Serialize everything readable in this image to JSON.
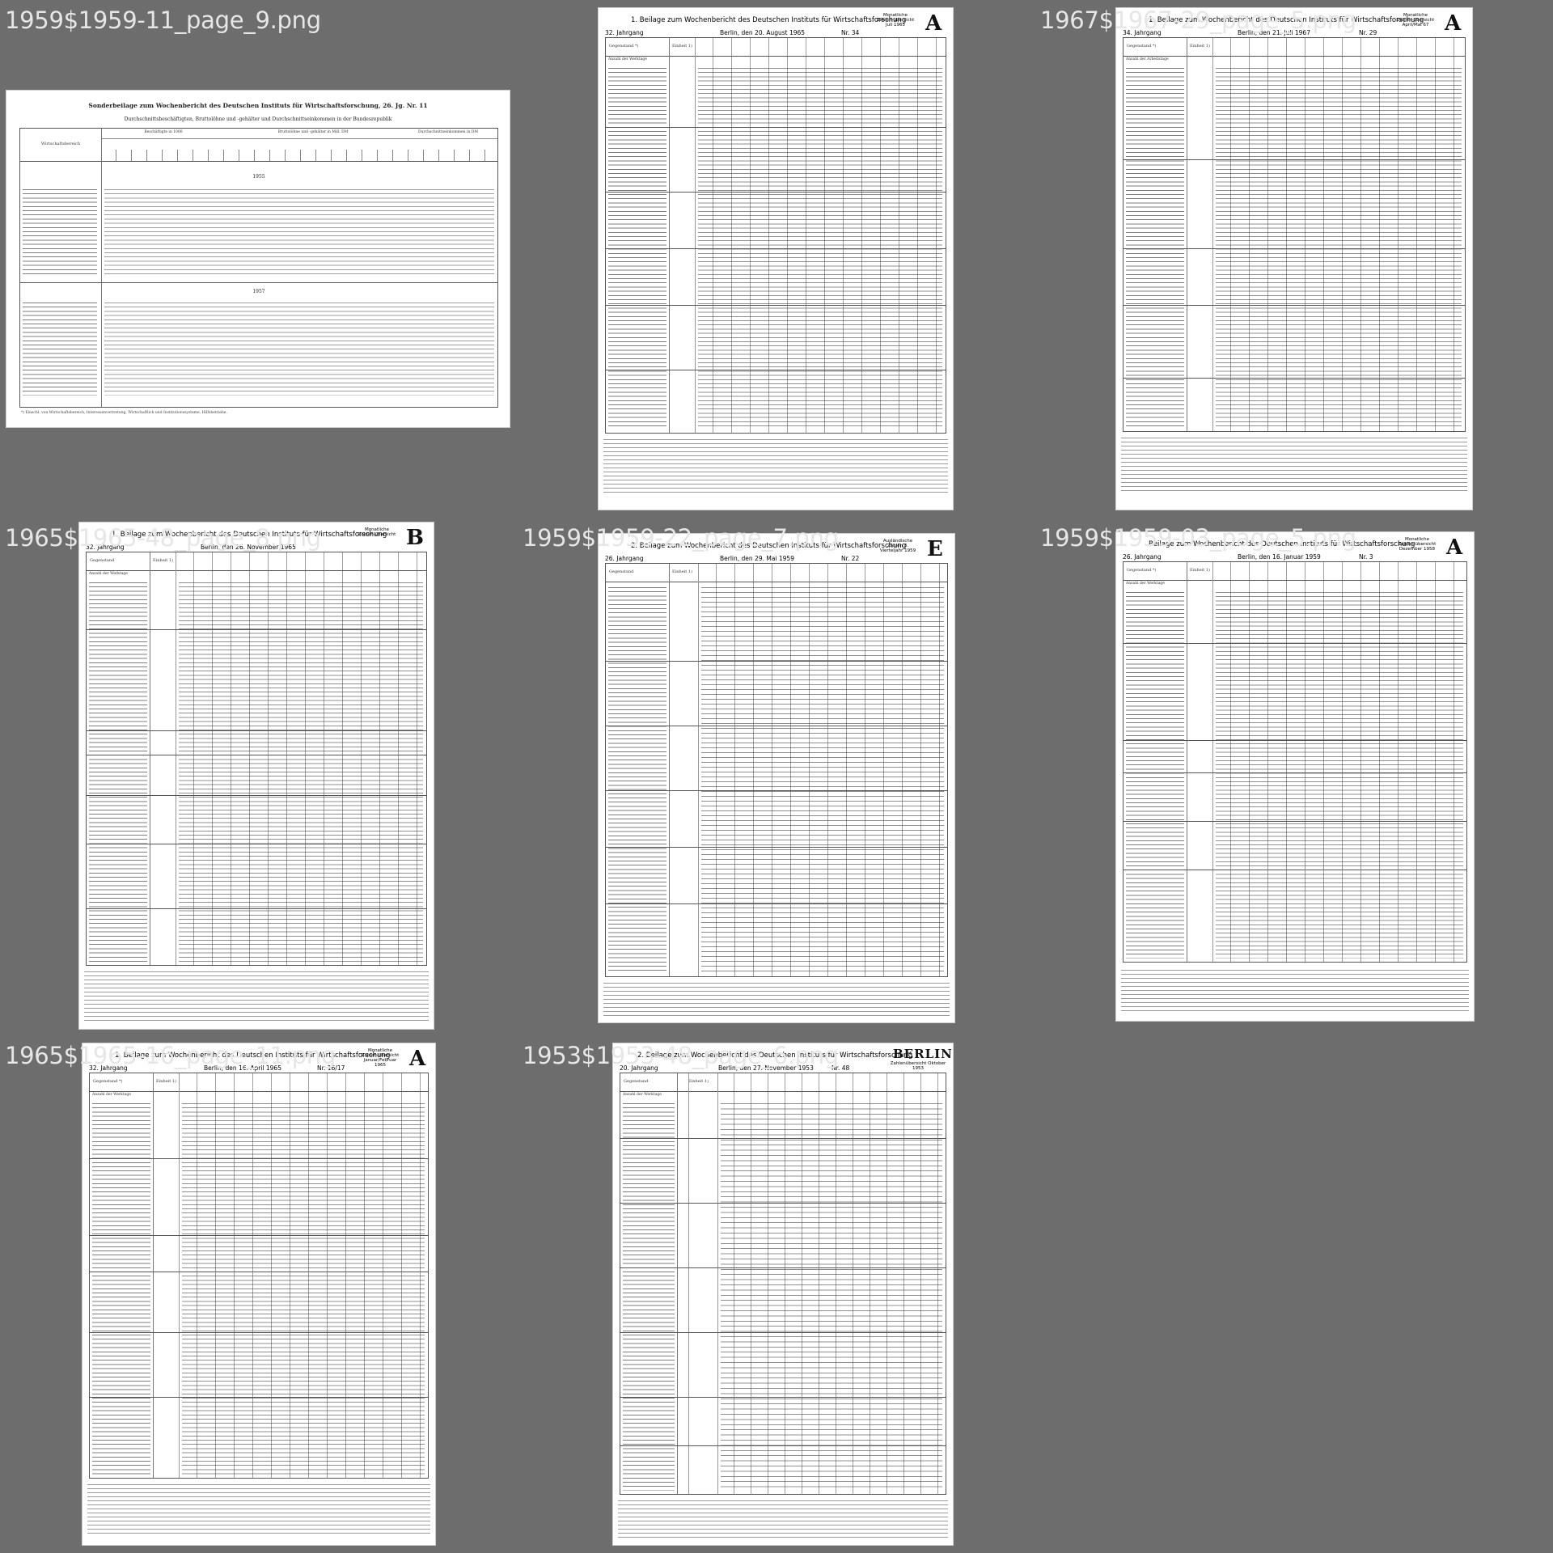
{
  "cells": [
    {
      "label": "1959$1959-11_page_9.png",
      "header_title": "Sonderbeilage zum Wochenbericht des Deutschen Instituts für Wirtschaftsforschung, 26. Jg. Nr. 11",
      "header_subtitle": "Durchschnittsbeschäftigten, Bruttolöhne und -gehälter und Durchschnittseinkommen in der Bundesrepublik",
      "stub_heading": "Wirtschaftsbereich",
      "group_headings": [
        "Beschäftigte in 1000",
        "Bruttolöhne und -gehälter in Mill. DM",
        "Durchschnittseinkommen in DM"
      ],
      "year_labels": [
        "1955",
        "1957"
      ],
      "footnote": "*) Einschl. von Wirtschaftsbereich, Interessenvertretung, Wirtschaftlich und Institutionssysteme, Hilfsbetriebe."
    },
    {
      "label": "1965$1965-34_page_8.png",
      "header_title": "1. Beilage zum Wochenbericht des Deutschen Instituts für Wirtschaftsforschung",
      "header_line2_left": "32. Jahrgang",
      "header_line2_center": "Berlin, den 20. August 1965",
      "header_line2_right": "Nr. 34",
      "side_note": "Monatliche Zahlen-übersicht Juli 1965",
      "letter": "A",
      "stub_heading": "Gegenstand *)",
      "unit_heading": "Einheit 1)",
      "first_row": "Anzahl der Werktage"
    },
    {
      "label": "1967$1967-29_page_5.png",
      "header_title": "1. Beilage zum Wochenbericht des Deutschen Instituts für Wirtschaftsforschung",
      "header_line2_left": "34. Jahrgang",
      "header_line2_center": "Berlin, den 21. Juli 1967",
      "header_line2_right": "Nr. 29",
      "side_note": "Monatliche Zahlen-übersicht April/Mai 67",
      "letter": "A",
      "stub_heading": "Gegenstand *)",
      "unit_heading": "Einheit 1)",
      "first_row": "Anzahl der Arbeitstage"
    },
    {
      "label": "1965$1965-48_page_8.png",
      "header_title": "1. Beilage zum Wochenbericht des Deutschen Instituts für Wirtschaftsforschung",
      "header_line2_left": "32. Jahrgang",
      "header_line2_center": "Berlin, den 26. November 1965",
      "header_line2_right": "",
      "side_note": "Monatliche Zahlen-übersicht",
      "letter": "B",
      "stub_heading": "Gegenstand",
      "unit_heading": "Einheit 1)",
      "first_row": "Anzahl der Werktage"
    },
    {
      "label": "1959$1959-22_page_7.png",
      "header_title": "2. Beilage zum Wochenbericht des Deutschen Instituts für Wirtschaftsforschung",
      "header_line2_left": "26. Jahrgang",
      "header_line2_center": "Berlin, den 29. Mai 1959",
      "header_line2_right": "Nr. 22",
      "side_note": "Ausländische Zahlen 3. Vierteljahr 1959",
      "letter": "E",
      "stub_heading": "Gegenstand",
      "unit_heading": "Einheit 1)",
      "first_row": ""
    },
    {
      "label": "1959$1959-03_page_5.png",
      "header_title": "Beilage zum Wochenbericht des Deutschen Instituts für Wirtschaftsforschung",
      "header_line2_left": "26. Jahrgang",
      "header_line2_center": "Berlin, den 16. Januar 1959",
      "header_line2_right": "Nr. 3",
      "side_note": "Monatliche Zahlen-übersicht Dezember 1958",
      "letter": "A",
      "stub_heading": "Gegenstand *)",
      "unit_heading": "Einheit 1)",
      "first_row": "Anzahl der Werktage"
    },
    {
      "label": "1965$1965-16_page_11.png",
      "header_title": "1. Beilage zum Wochenbericht des Deutschen Instituts für Wirtschaftsforschung",
      "header_line2_left": "32. Jahrgang",
      "header_line2_center": "Berlin, den 16. April 1965",
      "header_line2_right": "Nr. 16/17",
      "side_note": "Monatliche Zahlen-übersicht Januar/Februar 1965",
      "letter": "A",
      "stub_heading": "Gegenstand *)",
      "unit_heading": "Einheit 1)",
      "first_row": "Anzahl der Werktage"
    },
    {
      "label": "1953$1953-48_page_6.png",
      "header_title": "2. Beilage zum Wochenbericht des Deutschen Instituts für Wirtschaftsforschung",
      "header_line2_left": "20. Jahrgang",
      "header_line2_center": "Berlin, den 27. November 1953",
      "header_line2_right": "Nr. 48",
      "side_note": "Zahlenübersicht Oktober 1953",
      "letter": "BERLIN",
      "stub_heading": "Gegenstand",
      "unit_heading": "Einheit 1)",
      "first_row": "Anzahl der Werktage"
    }
  ]
}
